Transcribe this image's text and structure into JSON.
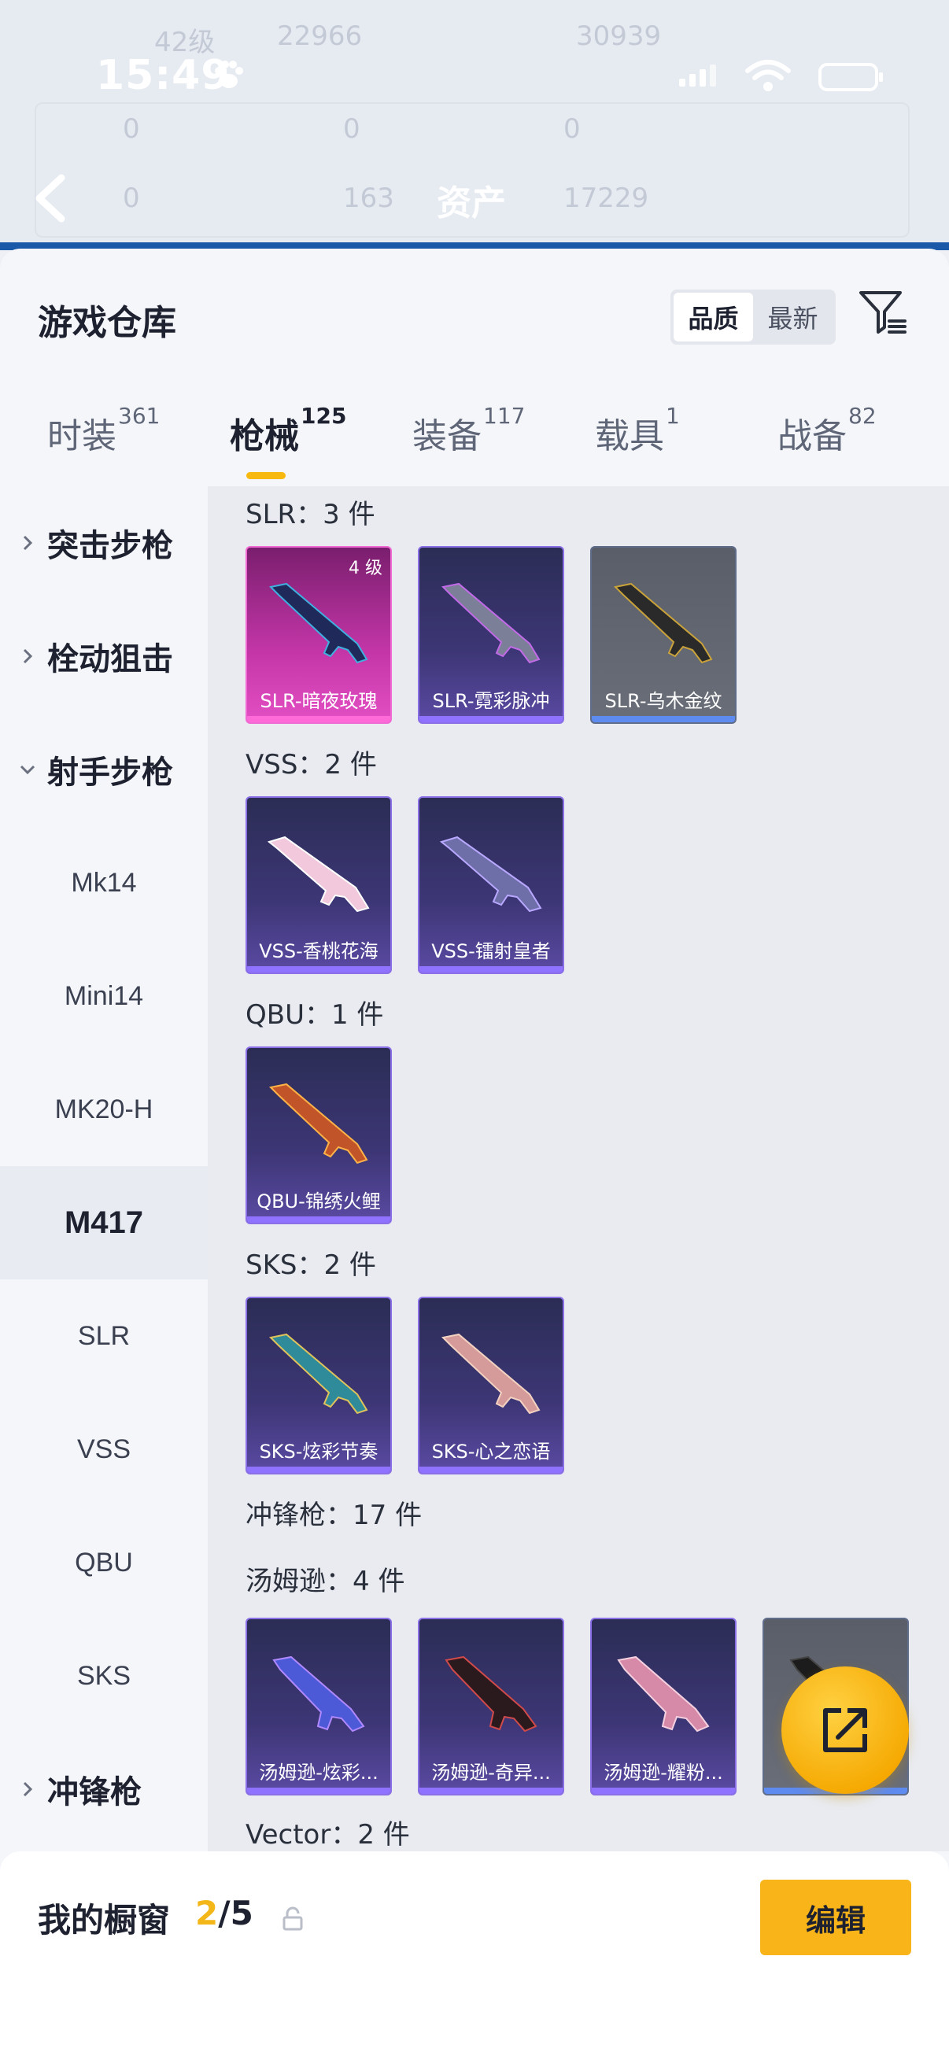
{
  "status_bar": {
    "time": "15:49"
  },
  "header": {
    "title": "资产",
    "faded_stats": [
      "42级",
      "22966",
      "30939",
      "0",
      "0",
      "0",
      "0",
      "163",
      "17229"
    ]
  },
  "sheet": {
    "title": "游戏仓库",
    "sort_options": [
      "品质",
      "最新"
    ],
    "sort_selected": "品质"
  },
  "tabs": [
    {
      "label": "时装",
      "count": "361"
    },
    {
      "label": "枪械",
      "count": "125",
      "active": true
    },
    {
      "label": "装备",
      "count": "117"
    },
    {
      "label": "载具",
      "count": "1"
    },
    {
      "label": "战备",
      "count": "82"
    }
  ],
  "sidebar": {
    "categories": [
      {
        "label": "突击步枪",
        "expanded": false
      },
      {
        "label": "栓动狙击",
        "expanded": false
      },
      {
        "label": "射手步枪",
        "expanded": true
      },
      {
        "label": "冲锋枪",
        "expanded": false
      }
    ],
    "sub_items": [
      "Mk14",
      "Mini14",
      "MK20-H",
      "M417",
      "SLR",
      "VSS",
      "QBU",
      "SKS"
    ],
    "selected_sub": "M417"
  },
  "groups": {
    "slr": {
      "title": "SLR：3 件",
      "items": [
        {
          "name": "SLR-暗夜玫瑰",
          "level": "4 级",
          "rarity": "pink",
          "color": "#c436a8"
        },
        {
          "name": "SLR-霓彩脉冲",
          "rarity": "purple",
          "color": "#3d3676"
        },
        {
          "name": "SLR-乌木金纹",
          "rarity": "gray",
          "color": "#6a6e78"
        }
      ]
    },
    "vss": {
      "title": "VSS：2 件",
      "items": [
        {
          "name": "VSS-香桃花海",
          "rarity": "purple"
        },
        {
          "name": "VSS-镭射皇者",
          "rarity": "purple"
        }
      ]
    },
    "qbu": {
      "title": "QBU：1 件",
      "items": [
        {
          "name": "QBU-锦绣火鲤",
          "rarity": "purple"
        }
      ]
    },
    "sks": {
      "title": "SKS：2 件",
      "items": [
        {
          "name": "SKS-炫彩节奏",
          "rarity": "purple"
        },
        {
          "name": "SKS-心之恋语",
          "rarity": "purple"
        }
      ]
    },
    "smg_header": "冲锋枪：17 件",
    "thompson": {
      "title": "汤姆逊：4 件",
      "items": [
        {
          "name": "汤姆逊-炫彩...",
          "rarity": "purple"
        },
        {
          "name": "汤姆逊-奇异...",
          "rarity": "purple"
        },
        {
          "name": "汤姆逊-耀粉...",
          "rarity": "purple"
        },
        {
          "name": "汤...",
          "rarity": "gray"
        }
      ]
    },
    "vector": {
      "title": "Vector：2 件"
    }
  },
  "showcase": {
    "label": "我的橱窗",
    "current": "2",
    "max": "/5",
    "edit_label": "编辑"
  },
  "colors": {
    "accent": "#f8b418",
    "tab_indicator": "#f7b90f",
    "rare_pink": "#e34fc4",
    "rare_purple": "#5b4aa3"
  },
  "icons": [
    "paw-icon",
    "back-arrow-icon",
    "filter-icon",
    "chevron-right-icon",
    "chevron-down-icon",
    "share-icon",
    "lock-icon"
  ]
}
